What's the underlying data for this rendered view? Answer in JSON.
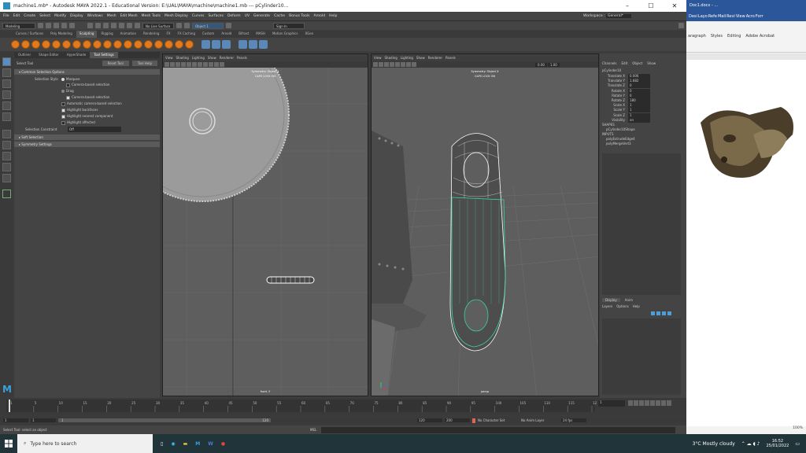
{
  "window": {
    "title": "machine1.mb* - Autodesk MAYA 2022.1 - Educational Version: E:\\UAL\\MAYA\\machine\\machine1.mb  ---  pCylinder10..."
  },
  "menu": {
    "items": [
      "File",
      "Edit",
      "Create",
      "Select",
      "Modify",
      "Display",
      "Windows",
      "Mesh",
      "Edit Mesh",
      "Mesh Tools",
      "Mesh Display",
      "Curves",
      "Surfaces",
      "Deform",
      "UV",
      "Generate",
      "Cache",
      "Bonus Tools",
      "Arnold",
      "Help"
    ],
    "workspace_label": "Workspace :",
    "workspace_value": "General*"
  },
  "status": {
    "mode": "Modeling",
    "live_surface": "No Live Surface",
    "object": "Object 1",
    "signin": "Sign In"
  },
  "shelf": {
    "tabs": [
      "Curves / Surfaces",
      "Poly Modeling",
      "Sculpting",
      "Rigging",
      "Animation",
      "Rendering",
      "FX",
      "FX Caching",
      "Custom",
      "Arnold",
      "Bifrost",
      "MASH",
      "Motion Graphics",
      "XGen"
    ],
    "active": "Sculpting"
  },
  "tool_tabs": [
    "Outliner",
    "Shape Editor",
    "HyperShade",
    "Tool Settings"
  ],
  "tool": {
    "name": "Select Tool",
    "reset": "Reset Tool",
    "help": "Tool Help",
    "section_common": "Common Selection Options",
    "selection_style_label": "Selection Style",
    "marquee": "Marquee",
    "camera_based": "Camera-based selection",
    "drag": "Drag",
    "camera_based2": "Camera-based selection",
    "auto_camera": "Automatic camera-based selection",
    "hl_backfaces": "Highlight backfaces",
    "hl_nearest": "Highlight nearest component",
    "hl_affected": "Highlight affected",
    "constraint_label": "Selection Constraint",
    "constraint_value": "Off",
    "soft": "Soft Selection",
    "symmetry": "Symmetry Settings"
  },
  "viewport_menu": [
    "View",
    "Shading",
    "Lighting",
    "Show",
    "Renderer",
    "Panels"
  ],
  "vp1": {
    "symmetry": "Symmetry: Object X",
    "caps": "CAPS LOCK ON",
    "camera": "front -Y"
  },
  "vp2": {
    "symmetry": "Symmetry: Object X",
    "caps": "CAPS LOCK ON",
    "camera": "persp",
    "gamma": "0.00",
    "exposure": "1.00"
  },
  "channel": {
    "menu": [
      "Channels",
      "Edit",
      "Object",
      "Show"
    ],
    "object": "pCylinder10",
    "attrs": [
      [
        "Translate X",
        "0.006"
      ],
      [
        "Translate Y",
        "1.682"
      ],
      [
        "Translate Z",
        "0"
      ],
      [
        "Rotate X",
        "0"
      ],
      [
        "Rotate Y",
        "0"
      ],
      [
        "Rotate Z",
        "180"
      ],
      [
        "Scale X",
        "1"
      ],
      [
        "Scale Y",
        "1"
      ],
      [
        "Scale Z",
        "1"
      ],
      [
        "Visibility",
        "on"
      ]
    ],
    "shapes_h": "SHAPES",
    "shape": "pCylinder10Shape",
    "inputs_h": "INPUTS",
    "inputs": [
      "polyExtrudeEdge4",
      "polyMergeVert3"
    ]
  },
  "layers": {
    "tabs": [
      "Display",
      "Anim"
    ],
    "menu": [
      "Layers",
      "Options",
      "Help"
    ]
  },
  "range": {
    "start": "1",
    "inner_start": "1",
    "inner_end": "120",
    "end": "120",
    "end2": "200",
    "char": "No Character Set",
    "anim": "No Anim Layer",
    "fps": "24 fps"
  },
  "current_frame": "1",
  "mel": {
    "label": "MEL",
    "help": "Select Tool: select an object"
  },
  "timeline_ticks": [
    "1",
    "5",
    "10",
    "15",
    "20",
    "25",
    "30",
    "35",
    "40",
    "45",
    "50",
    "55",
    "60",
    "65",
    "70",
    "75",
    "80",
    "85",
    "90",
    "95",
    "100",
    "105",
    "110",
    "115",
    "12"
  ],
  "word": {
    "title": "Doc1.docx - ...",
    "tabs": [
      "Desi",
      "Layo",
      "Refe",
      "Mail",
      "Revi",
      "View",
      "Acro",
      "Forr"
    ],
    "groups": [
      "aragraph",
      "Styles",
      "Editing",
      "Adobe Acrobat"
    ],
    "zoom": "100%"
  },
  "taskbar": {
    "search": "Type here to search",
    "weather": "3°C  Mostly cloudy",
    "time": "16:52",
    "date": "25/01/2022"
  }
}
